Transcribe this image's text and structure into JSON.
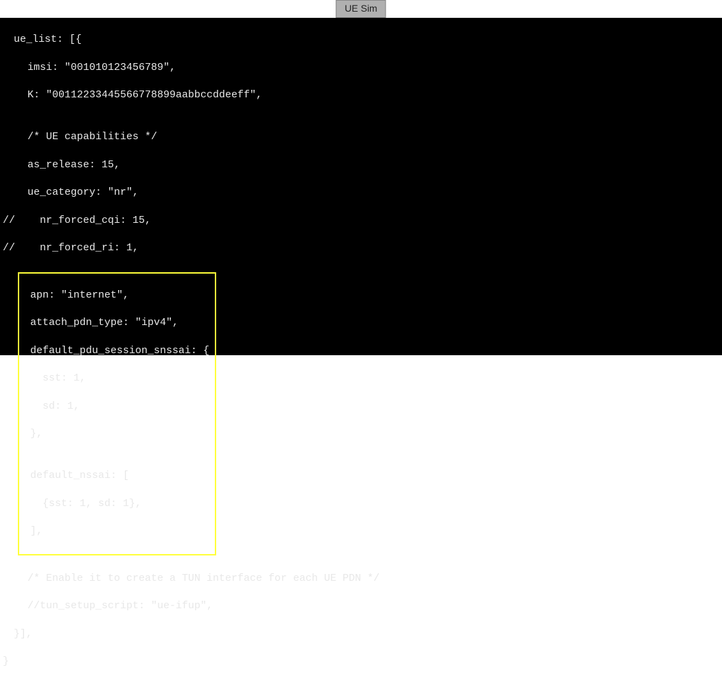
{
  "tab": {
    "label": "UE Sim"
  },
  "code": {
    "l1": "ue_list: [{",
    "l2": "imsi: \"001010123456789\",",
    "l3": "K: \"00112233445566778899aabbccddeeff\",",
    "l4": "",
    "l5": "/* UE capabilities */",
    "l6": "as_release: 15,",
    "l7": "ue_category: \"nr\",",
    "l8": "//    nr_forced_cqi: 15,",
    "l9": "//    nr_forced_ri: 1,",
    "hl1": "apn: \"internet\",",
    "hl2": "attach_pdn_type: \"ipv4\",",
    "hl3": "default_pdu_session_snssai: {",
    "hl4": "sst: 1,",
    "hl5": "sd: 1,",
    "hl6": "},",
    "hl7": "",
    "hl8": "default_nssai: [",
    "hl9": "{sst: 1, sd: 1},",
    "hl10": "],",
    "l10": "",
    "l11": "/* Enable it to create a TUN interface for each UE PDN */",
    "l12": "//tun_setup_script: \"ue-ifup\",",
    "l13": "}],",
    "l14": "}"
  }
}
